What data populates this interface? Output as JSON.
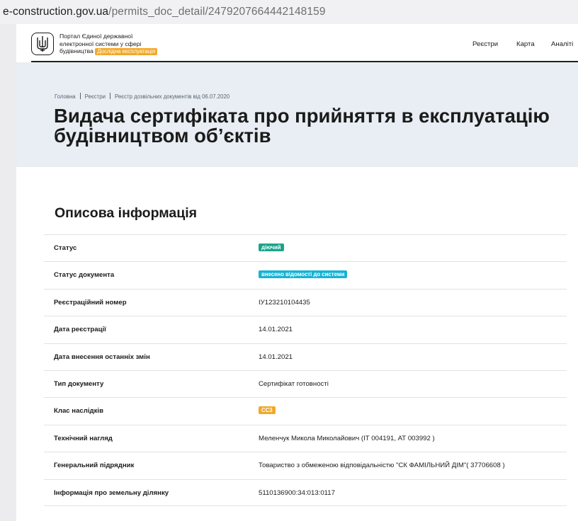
{
  "browser": {
    "url_host": "e-construction.gov.ua",
    "url_path": "/permits_doc_detail/2479207664442148159"
  },
  "header": {
    "portal_line1": "Портал Єдиної державної",
    "portal_line2": "електронної системи у сфері",
    "portal_line3": "будівництва",
    "beta_badge": "Дослідна експлуатація",
    "nav": [
      "Реєстри",
      "Карта",
      "Аналіті"
    ]
  },
  "breadcrumbs": [
    "Головна",
    "Реєстри",
    "Реєстр дозвільних документів від 06.07.2020"
  ],
  "page": {
    "title_line1": "Видача сертифіката про прийняття в експлуатацію",
    "title_line2": "будівництвом об’єктів",
    "section_title": "Описова інформація"
  },
  "details": [
    {
      "label": "Статус",
      "value": "діючий",
      "badge_color": "#1aa58a"
    },
    {
      "label": "Статус документа",
      "value": "внесено відомості до системи",
      "badge_color": "#16b3d6"
    },
    {
      "label": "Реєстраційний номер",
      "value": "ІУ123210104435"
    },
    {
      "label": "Дата реєстрації",
      "value": "14.01.2021"
    },
    {
      "label": "Дата внесення останніх змін",
      "value": "14.01.2021"
    },
    {
      "label": "Тип документу",
      "value": "Сертифікат готовності"
    },
    {
      "label": "Клас наслідків",
      "value": "СС3",
      "badge_color": "#f2a829"
    },
    {
      "label": "Технічний нагляд",
      "value": "Меленчук Микола Миколайович (ІТ 004191, АТ 003992 )"
    },
    {
      "label": "Генеральний підрядник",
      "value": "Товариство з обмеженою відповідальністю \"СК ФАМІЛЬНИЙ ДІМ\"( 37706608 )"
    },
    {
      "label": "Інформація про земельну ділянку",
      "value": "5110136900:34:013:0117"
    }
  ],
  "icons": {
    "logo": "ukraine-trident-icon"
  }
}
